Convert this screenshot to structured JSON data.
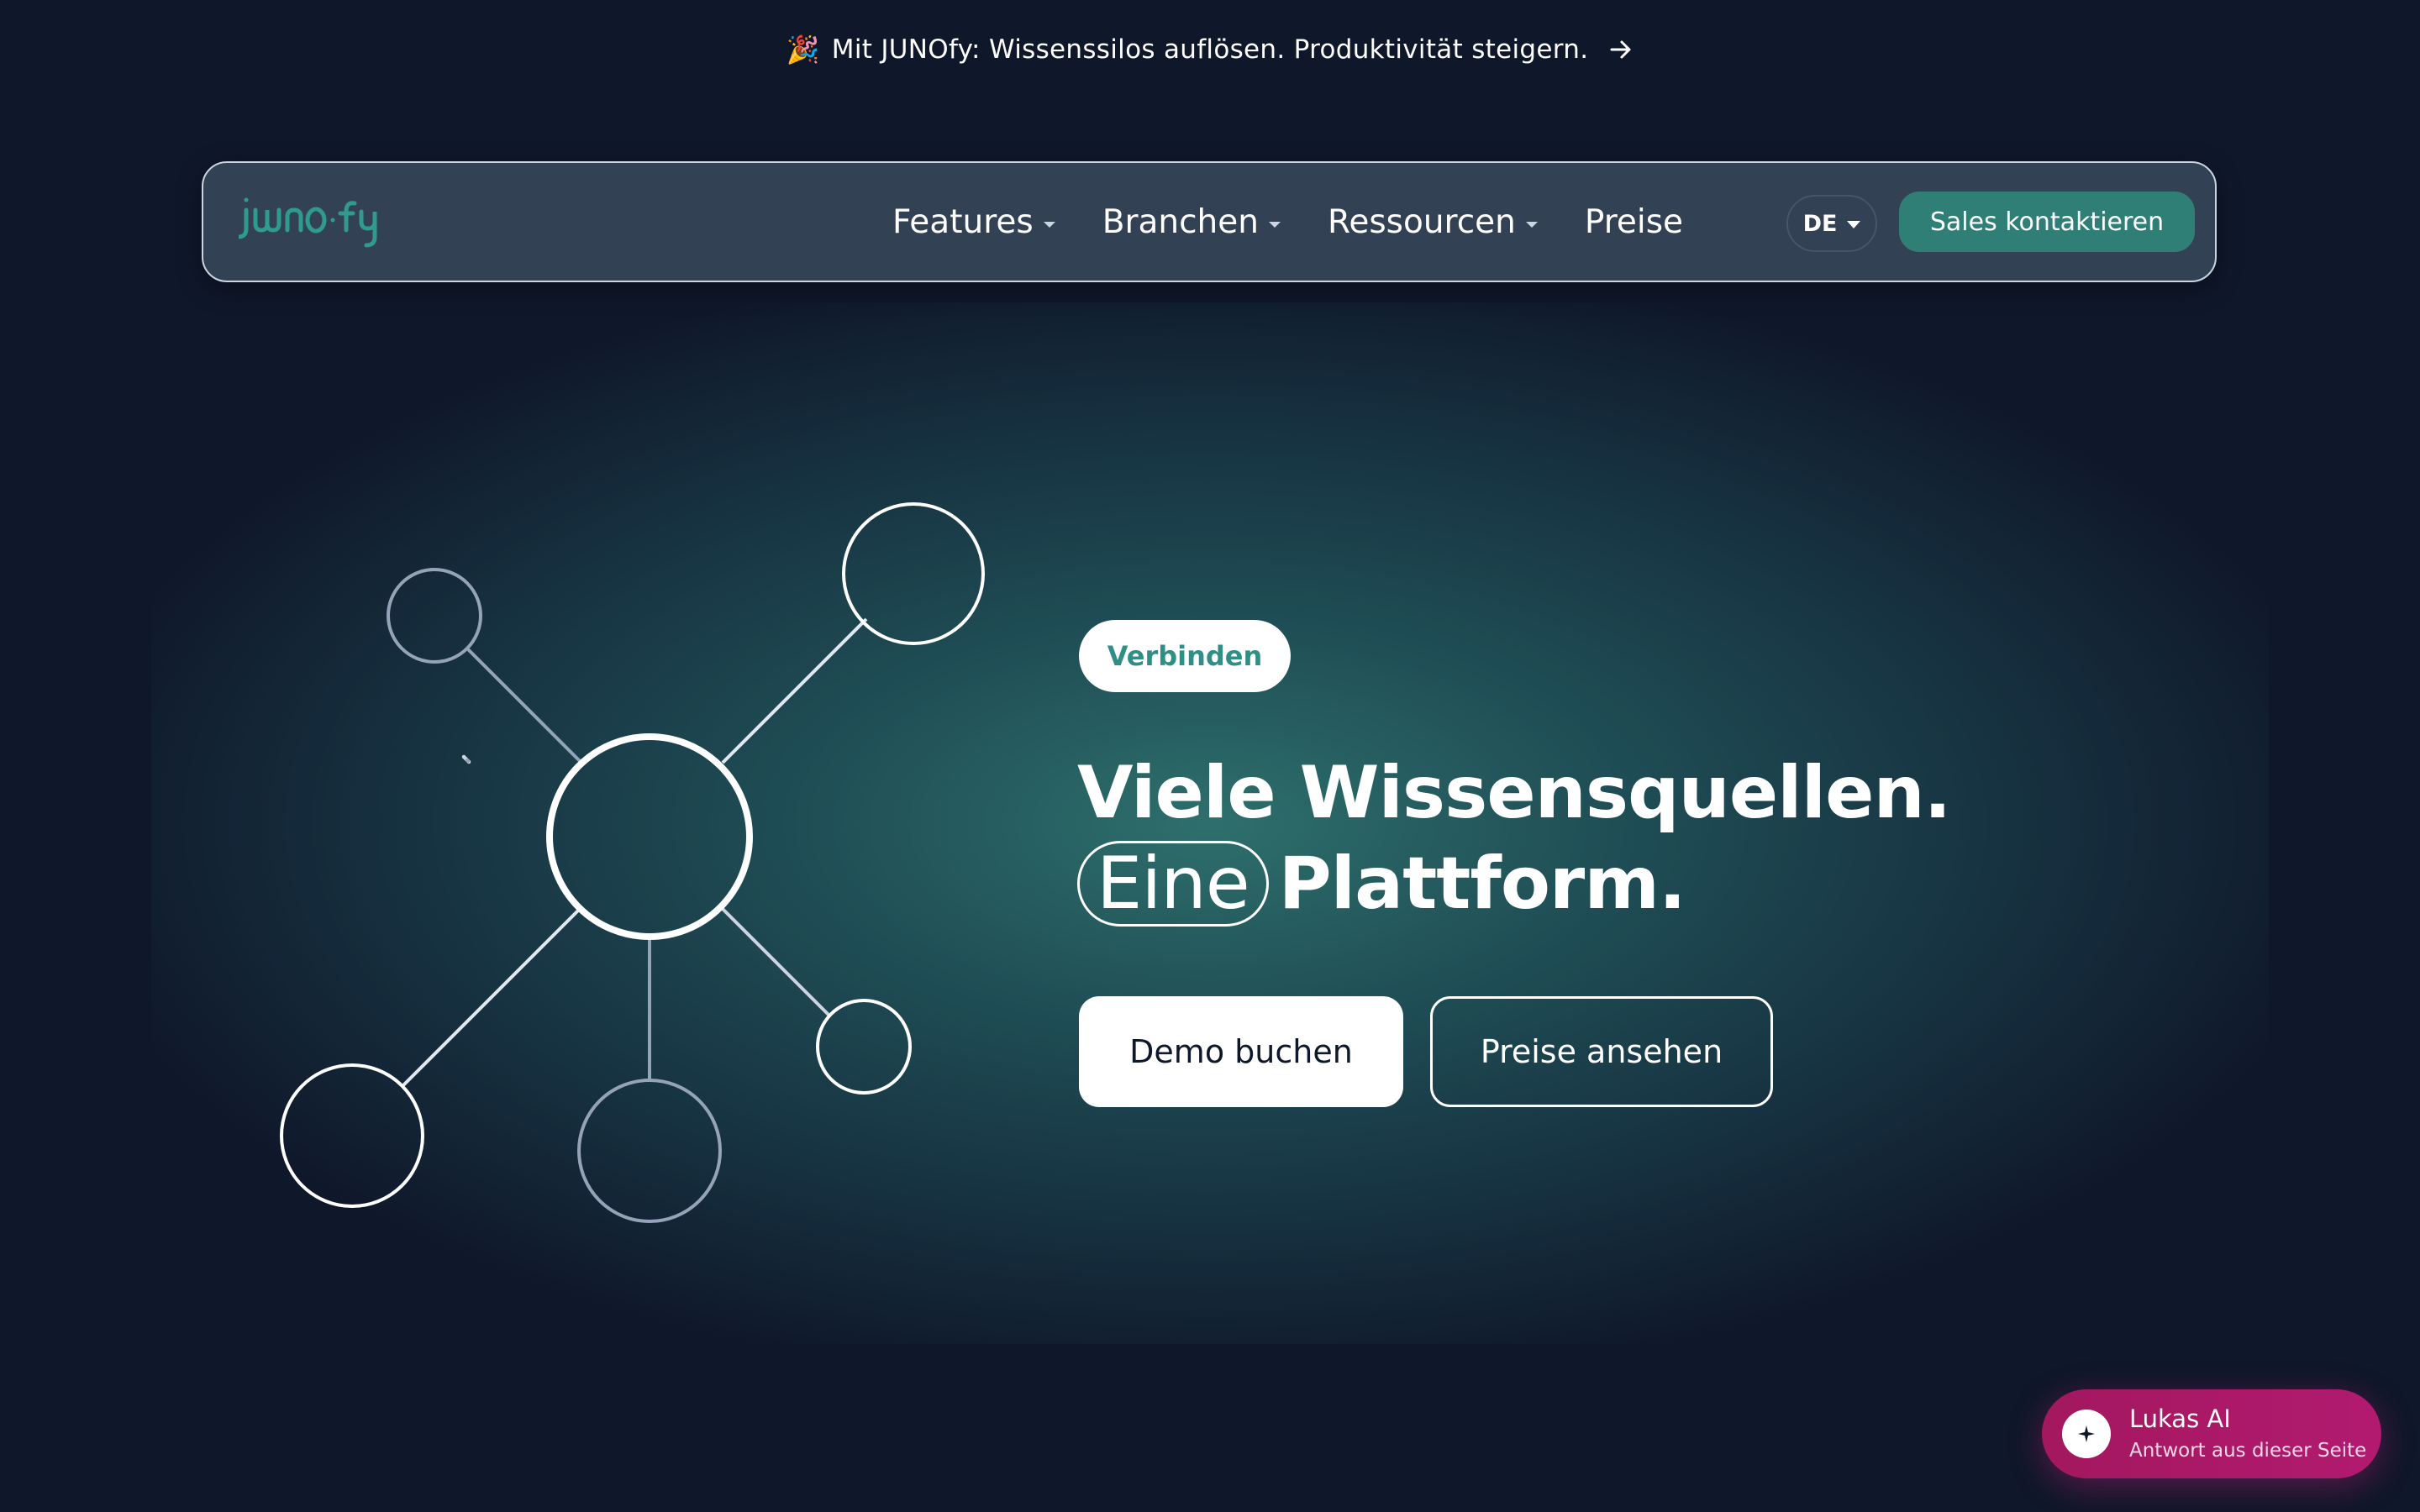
{
  "announcement": {
    "emoji": "🎉",
    "text": "Mit JUNOfy: Wissenssilos auflösen. Produktivität steigern.",
    "arrow_icon": "arrow-right-icon"
  },
  "nav": {
    "logo": "JUNOfy",
    "items": [
      {
        "label": "Features",
        "has_dropdown": true
      },
      {
        "label": "Branchen",
        "has_dropdown": true
      },
      {
        "label": "Ressourcen",
        "has_dropdown": true
      },
      {
        "label": "Preise",
        "has_dropdown": false
      }
    ],
    "language": "DE",
    "cta": "Sales kontaktieren"
  },
  "hero": {
    "badge": "Verbinden",
    "headline_line1": "Viele Wissensquellen.",
    "headline_highlight": "Eine",
    "headline_line2_rest": "Plattform.",
    "primary_button": "Demo buchen",
    "secondary_button": "Preise ansehen"
  },
  "chat_widget": {
    "title": "Lukas AI",
    "subtitle": "Antwort aus dieser Seite",
    "icon": "sparkle-icon"
  },
  "colors": {
    "background": "#0f172a",
    "accent": "#2f7f77",
    "badge_text": "#2f8f86",
    "chat": "#b21a70"
  }
}
